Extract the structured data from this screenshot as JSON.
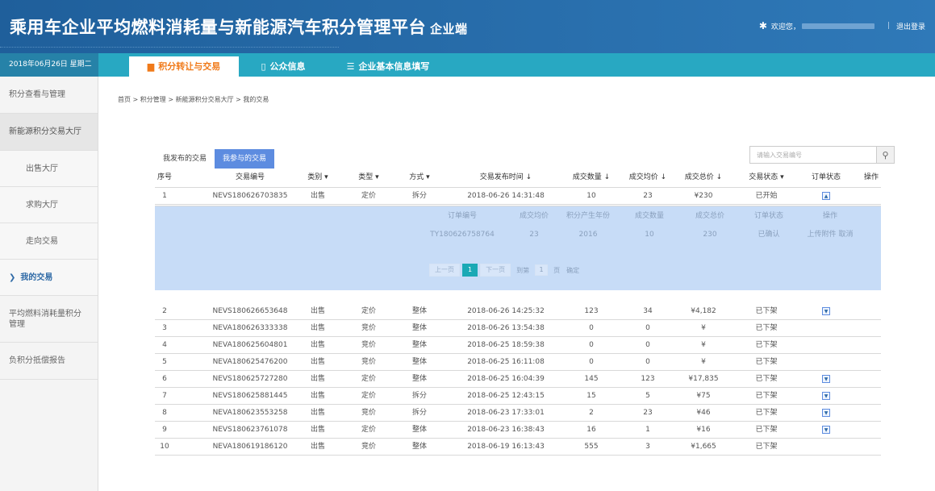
{
  "header": {
    "title": "乘用车企业平均燃料消耗量与新能源汽车积分管理平台",
    "subtitle": "企业端",
    "welcome": "欢迎您，",
    "separator": "|",
    "logout": "退出登录"
  },
  "tabbar": {
    "date": "2018年06月26日 星期二",
    "tabs": [
      {
        "label": "积分转让与交易",
        "icon": "bar-chart-icon"
      },
      {
        "label": "公众信息",
        "icon": "document-icon"
      },
      {
        "label": "企业基本信息填写",
        "icon": "form-icon"
      }
    ]
  },
  "sidebar": {
    "items": [
      {
        "label": "积分查看与管理"
      },
      {
        "label": "新能源积分交易大厅"
      },
      {
        "label": "出售大厅"
      },
      {
        "label": "求购大厅"
      },
      {
        "label": "走向交易"
      },
      {
        "label": "我的交易",
        "icon": "chevron-right-icon"
      },
      {
        "label": "平均燃料消耗量积分管理"
      },
      {
        "label": "负积分抵偿报告"
      }
    ]
  },
  "breadcrumb": "首页 > 积分管理 > 新能源积分交易大厅 > 我的交易",
  "subtabs": [
    "我发布的交易",
    "我参与的交易"
  ],
  "search": {
    "placeholder": "请输入交易编号"
  },
  "table": {
    "headers": [
      "序号",
      "交易编号",
      "类别 ▾",
      "类型 ▾",
      "方式 ▾",
      "交易发布时间 ↓",
      "成交数量 ↓",
      "成交均价 ↓",
      "成交总价 ↓",
      "交易状态 ▾",
      "订单状态",
      "操作"
    ],
    "rows": [
      {
        "no": "1",
        "code": "NEVS180626703835",
        "category": "出售",
        "type": "定价",
        "method": "拆分",
        "time": "2018-06-26 14:31:48",
        "qty": "10",
        "avg": "23",
        "total": "¥230",
        "status": "已开始",
        "toggle": "▲"
      },
      {
        "no": "2",
        "code": "NEVS180626653648",
        "category": "出售",
        "type": "定价",
        "method": "整体",
        "time": "2018-06-26 14:25:32",
        "qty": "123",
        "avg": "34",
        "total": "¥4,182",
        "status": "已下架",
        "toggle": "▼"
      },
      {
        "no": "3",
        "code": "NEVA180626333338",
        "category": "出售",
        "type": "竞价",
        "method": "整体",
        "time": "2018-06-26 13:54:38",
        "qty": "0",
        "avg": "0",
        "total": "¥",
        "status": "已下架",
        "toggle": ""
      },
      {
        "no": "4",
        "code": "NEVA180625604801",
        "category": "出售",
        "type": "竞价",
        "method": "整体",
        "time": "2018-06-25 18:59:38",
        "qty": "0",
        "avg": "0",
        "total": "¥",
        "status": "已下架",
        "toggle": ""
      },
      {
        "no": "5",
        "code": "NEVA180625476200",
        "category": "出售",
        "type": "竞价",
        "method": "整体",
        "time": "2018-06-25 16:11:08",
        "qty": "0",
        "avg": "0",
        "total": "¥",
        "status": "已下架",
        "toggle": ""
      },
      {
        "no": "6",
        "code": "NEVS180625727280",
        "category": "出售",
        "type": "定价",
        "method": "整体",
        "time": "2018-06-25 16:04:39",
        "qty": "145",
        "avg": "123",
        "total": "¥17,835",
        "status": "已下架",
        "toggle": "▼"
      },
      {
        "no": "7",
        "code": "NEVS180625881445",
        "category": "出售",
        "type": "定价",
        "method": "拆分",
        "time": "2018-06-25 12:43:15",
        "qty": "15",
        "avg": "5",
        "total": "¥75",
        "status": "已下架",
        "toggle": "▼"
      },
      {
        "no": "8",
        "code": "NEVA180623553258",
        "category": "出售",
        "type": "竞价",
        "method": "拆分",
        "time": "2018-06-23 17:33:01",
        "qty": "2",
        "avg": "23",
        "total": "¥46",
        "status": "已下架",
        "toggle": "▼"
      },
      {
        "no": "9",
        "code": "NEVS180623761078",
        "category": "出售",
        "type": "定价",
        "method": "整体",
        "time": "2018-06-23 16:38:43",
        "qty": "16",
        "avg": "1",
        "total": "¥16",
        "status": "已下架",
        "toggle": "▼"
      },
      {
        "no": "10",
        "code": "NEVA180619186120",
        "category": "出售",
        "type": "竞价",
        "method": "整体",
        "time": "2018-06-19 16:13:43",
        "qty": "555",
        "avg": "3",
        "total": "¥1,665",
        "status": "已下架",
        "toggle": ""
      }
    ]
  },
  "detail": {
    "headers": [
      "订单编号",
      "成交均价",
      "积分产生年份",
      "成交数量",
      "成交总价",
      "订单状态",
      "操作"
    ],
    "row": {
      "order": "TY180626758764",
      "avg": "23",
      "year": "2016",
      "qty": "10",
      "total": "230",
      "status": "已确认",
      "upload": "上传附件",
      "cancel": "取消"
    },
    "pager": {
      "prev": "上一页",
      "current": "1",
      "next": "下一页",
      "goto": "到第",
      "page_value": "1",
      "page_unit": "页",
      "confirm": "确定"
    }
  },
  "colors": {
    "header_bg": "#2a6fb0",
    "tabbar_bg": "#28a8c2",
    "active_tab_text": "#f07a1a",
    "subtab_active": "#5d8ce0",
    "detail_bg": "#c7dcf7",
    "pager_current": "#1aa9b5"
  }
}
